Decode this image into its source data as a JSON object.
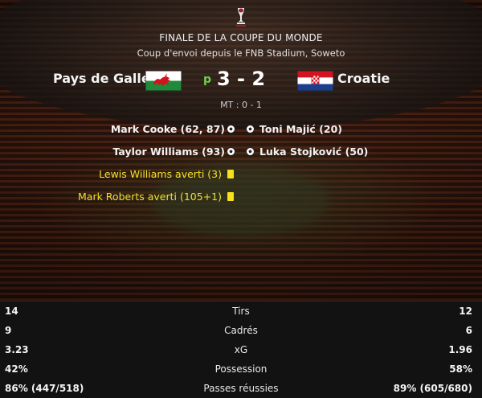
{
  "header": {
    "title": "FINALE DE LA COUPE DU MONDE",
    "subtitle": "Coup d'envoi depuis le FNB Stadium, Soweto"
  },
  "match": {
    "home_team": "Pays de Galles",
    "away_team": "Croatie",
    "home_flag": "wales-flag-icon",
    "away_flag": "croatia-flag-icon",
    "penalty_marker": "p",
    "score": "3 - 2",
    "halftime": "MT : 0 - 1"
  },
  "events": {
    "home_goals": [
      "Mark Cooke (62, 87)",
      "Taylor Williams (93)"
    ],
    "away_goals": [
      "Toni Majić (20)",
      "Luka Stojković (50)"
    ],
    "home_cards": [
      "Lewis Williams averti (3)",
      "Mark Roberts averti (105+1)"
    ]
  },
  "stats": [
    {
      "label": "Tirs",
      "home": "14",
      "away": "12"
    },
    {
      "label": "Cadrés",
      "home": "9",
      "away": "6"
    },
    {
      "label": "xG",
      "home": "3.23",
      "away": "1.96"
    },
    {
      "label": "Possession",
      "home": "42%",
      "away": "58%"
    },
    {
      "label": "Passes réussies",
      "home": "86% (447/518)",
      "away": "89% (605/680)"
    }
  ],
  "colors": {
    "penalty": "#6fd14a",
    "yellow_card": "#f5e11c",
    "stats_bg": "#121212"
  }
}
